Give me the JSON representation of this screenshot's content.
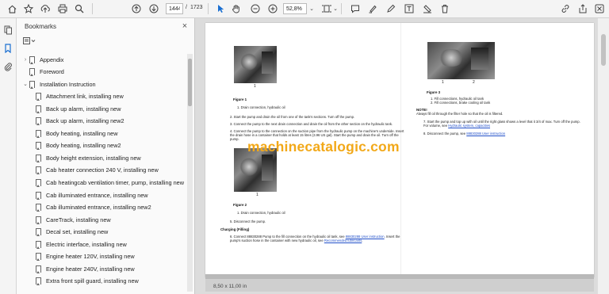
{
  "toolbar": {
    "page_current": "1444",
    "page_separator": "/",
    "page_total": "1723",
    "zoom": "52,8%",
    "icons": [
      "home-icon",
      "star-icon",
      "upload-icon",
      "print-icon",
      "search-icon",
      "arrow-up-icon",
      "arrow-down-icon",
      "cursor-icon",
      "hand-icon",
      "zoom-out-icon",
      "zoom-in-icon",
      "chevron-down-icon",
      "fit-page-icon",
      "chevron-down-icon",
      "comment-icon",
      "highlighter-icon",
      "draw-icon",
      "text-icon",
      "fill-sign-icon",
      "delete-icon",
      "link-icon",
      "share-icon"
    ]
  },
  "left_rail": {
    "icons": [
      "pages-icon",
      "bookmark-icon",
      "attachment-icon"
    ]
  },
  "bookmarks": {
    "title": "Bookmarks",
    "close_glyph": "×",
    "items": [
      {
        "label": "Appendix",
        "level": 0,
        "chevron": "›"
      },
      {
        "label": "Foreword",
        "level": 0,
        "chevron": ""
      },
      {
        "label": "Installation Instruction",
        "level": 0,
        "chevron": "⌄"
      },
      {
        "label": "Attachment link, installing new",
        "level": 1,
        "chevron": ""
      },
      {
        "label": "Back up alarm, installing new",
        "level": 1,
        "chevron": ""
      },
      {
        "label": "Back up alarm, installing new2",
        "level": 1,
        "chevron": ""
      },
      {
        "label": "Body heating, installing new",
        "level": 1,
        "chevron": ""
      },
      {
        "label": "Body heating, installing new2",
        "level": 1,
        "chevron": ""
      },
      {
        "label": "Body height extension, installing new",
        "level": 1,
        "chevron": ""
      },
      {
        "label": "Cab heater connection 240 V, installing new",
        "level": 1,
        "chevron": ""
      },
      {
        "label": "Cab heatingcab ventilation timer, pump, installing new",
        "level": 1,
        "chevron": ""
      },
      {
        "label": "Cab illuminated entrance, installing new",
        "level": 1,
        "chevron": ""
      },
      {
        "label": "Cab illuminated entrance, installing new2",
        "level": 1,
        "chevron": ""
      },
      {
        "label": "CareTrack, installing new",
        "level": 1,
        "chevron": ""
      },
      {
        "label": "Decal set, installing new",
        "level": 1,
        "chevron": ""
      },
      {
        "label": "Electric interface, installing new",
        "level": 1,
        "chevron": ""
      },
      {
        "label": "Engine heater 120V, installing new",
        "level": 1,
        "chevron": ""
      },
      {
        "label": "Engine heater 240V, installing new",
        "level": 1,
        "chevron": ""
      },
      {
        "label": "Extra front spill guard, installing new",
        "level": 1,
        "chevron": ""
      }
    ]
  },
  "document": {
    "watermark": "machinecatalogic.com",
    "left_page": {
      "figure1_label": "Figure 1",
      "figure1_callout": "1",
      "figure1_legend": "1.      Drain connection, hydraulic oil",
      "step2": "2.   Start the pump and drain the oil from one of the tank's sections. Turn off the pump.",
      "step3": "3.   Connect the pump to the next drain connection and drain the oil from the other section on the hydraulic tank.",
      "step4_a": "4.   Connect the pump to the connection on the suction pipe from the hydraulic pump on the machine's underside. Insert",
      "step4_b": "      the drain hose in a container that holds at least 15 litres (3.96 US gal). Start the pump and drain the oil. Turn off the",
      "step4_c": "      pump.",
      "figure2_label": "Figure 2",
      "figure2_callout": "1",
      "figure2_legend": "1.      Drain connection, hydraulic oil",
      "step5": "5.   Disconnect the pump.",
      "charging_heading": "Charging (Filling)",
      "step6_a_pre": "6.   Connect 88830288 Pump to the fill connection on the hydraulic oil tank, see ",
      "step6_a_link": "88830288 User instruction",
      "step6_a_post": ". Insert the",
      "step6_b_pre": "      pump's suction hose in the container with new hydraulic oil, see ",
      "step6_b_link": "Recommended lubricants",
      "step6_b_post": "."
    },
    "right_page": {
      "figure3_label": "Figure 3",
      "figure3_callouts": [
        "1",
        "2"
      ],
      "figure3_legend_1": "1.      Fill connections, hydraulic oil tank",
      "figure3_legend_2": "2.      Fill connections, brake cooling oil tank",
      "note_label": "NOTE!",
      "note_text": "Always fill oil through the filter hole so that the oil is filtered.",
      "step7_a": "7.   Start the pump and top up with oil until the right glass shows a level that it 3/4 of max. Turn off the pump.",
      "step7_b_pre": "      For volume, see ",
      "step7_b_link": "Hydraulic system, capacities",
      "step8_pre": "8.   Disconnect the pump, see ",
      "step8_link": "88830288 User instruction"
    },
    "page_size": "8,50 x 11,00 in"
  }
}
